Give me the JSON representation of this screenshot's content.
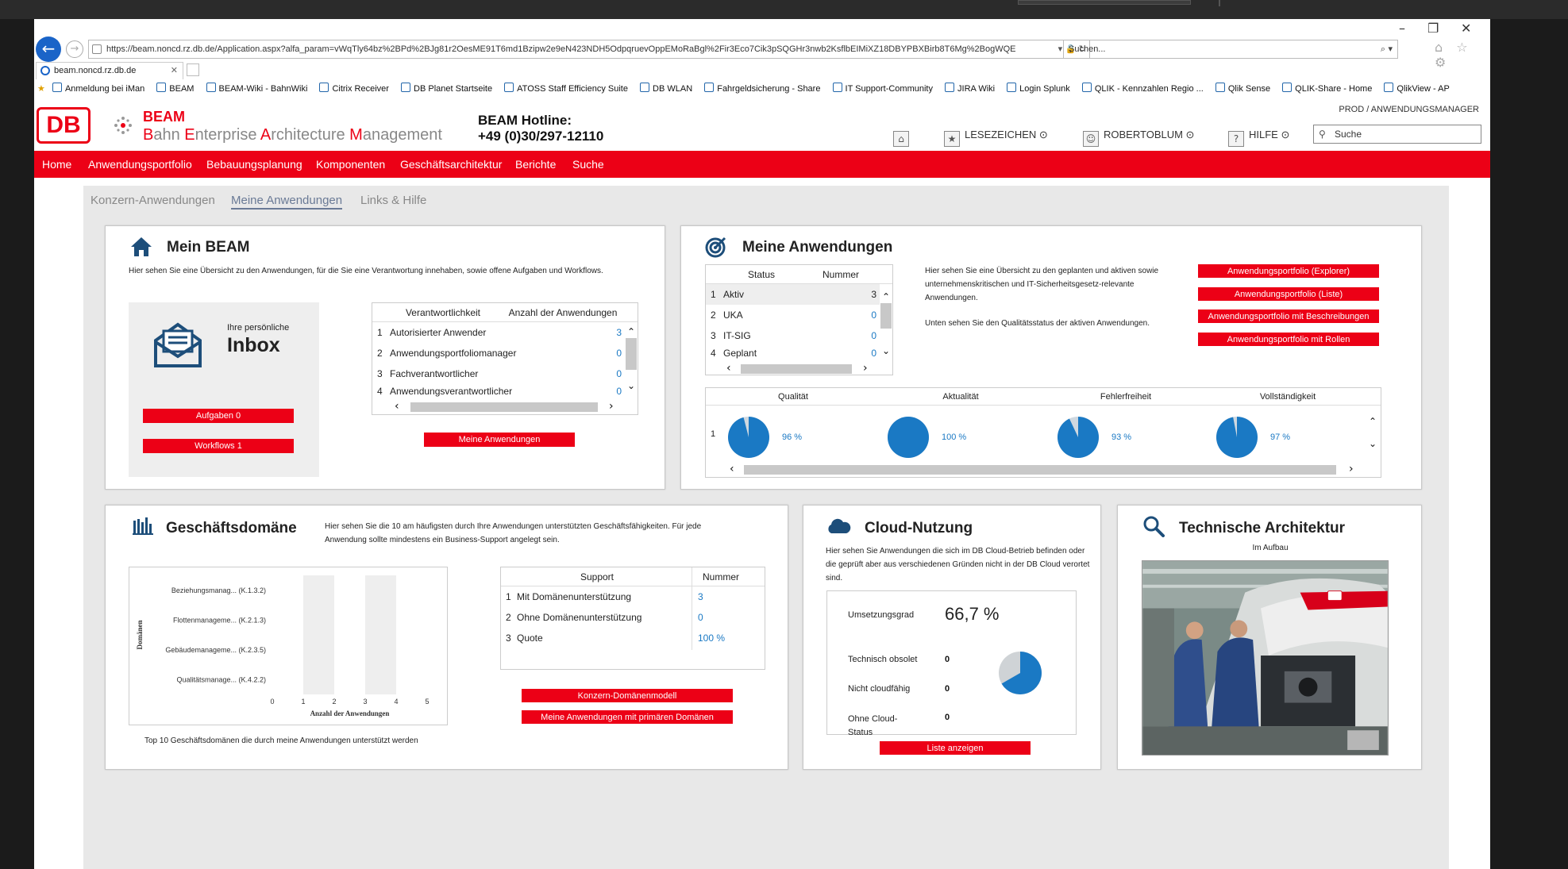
{
  "browser": {
    "url": "https://beam.noncd.rz.db.de/Application.aspx?alfa_param=vWqTly64bz%2BPd%2BJg81r2OesME91T6md1Bzipw2e9eN423NDH5OdpqruevOppEMoRaBgl%2Fir3Eco7Cik3pSQGHr3nwb2KsflbEIMiXZ18DBYPBXBirb8T6Mg%2BogWQE",
    "url_icons": "▾ 🔒 ↻",
    "search_placeholder": "Suchen...",
    "search_icon": "⌕ ▾",
    "tab_title": "beam.noncd.rz.db.de",
    "window_controls": {
      "minimize": "–",
      "restore": "❐",
      "close": "✕"
    },
    "chrome_icons": "⌂ ☆ ⚙",
    "favorites": [
      "Anmeldung bei iMan",
      "BEAM",
      "BEAM-Wiki - BahnWiki",
      "Citrix Receiver",
      "DB Planet Startseite",
      "ATOSS Staff Efficiency Suite",
      "DB WLAN",
      "Fahrgeldsicherung - Share",
      "IT Support-Community",
      "JIRA Wiki",
      "Login Splunk",
      "QLIK - Kennzahlen Regio ...",
      "Qlik Sense",
      "QLIK-Share - Home",
      "QlikView - AP"
    ]
  },
  "header": {
    "logo": "DB",
    "app_name": "BEAM",
    "app_subtitle_parts": [
      "B",
      "ahn ",
      "E",
      "nterprise ",
      "A",
      "rchitecture ",
      "M",
      "anagement"
    ],
    "hotline_label": "BEAM Hotline:",
    "hotline_number": "+49 (0)30/297-12110",
    "env_label": "PROD / ANWENDUNGSMANAGER",
    "home_icon": "home-icon",
    "bookmarks_label": "LESEZEICHEN ⊙",
    "user_label": "ROBERTOBLUM ⊙",
    "help_label": "HILFE ⊙",
    "search_placeholder": "Suche"
  },
  "nav": [
    "Home",
    "Anwendungsportfolio",
    "Bebauungsplanung",
    "Komponenten",
    "Geschäftsarchitektur",
    "Berichte",
    "Suche"
  ],
  "subtabs": [
    "Konzern-Anwendungen",
    "Meine Anwendungen",
    "Links & Hilfe"
  ],
  "mein_beam": {
    "title": "Mein BEAM",
    "desc": "Hier sehen Sie eine Übersicht zu den Anwendungen, für die Sie eine Verantwortung innehaben, sowie offene Aufgaben und Workflows.",
    "inbox_small": "Ihre persönliche",
    "inbox_big": "Inbox",
    "btn_tasks": "Aufgaben 0",
    "btn_workflows": "Workflows 1",
    "table_headers": [
      "Verantwortlichkeit",
      "Anzahl der Anwendungen"
    ],
    "rows": [
      {
        "n": "1",
        "label": "Autorisierter Anwender",
        "value": "3"
      },
      {
        "n": "2",
        "label": "Anwendungsportfoliomanager",
        "value": "0"
      },
      {
        "n": "3",
        "label": "Fachverantwortlicher",
        "value": "0"
      },
      {
        "n": "4",
        "label": "Anwendungsverantwortlicher",
        "value": "0"
      }
    ],
    "btn_apps": "Meine Anwendungen"
  },
  "meine_anwendungen": {
    "title": "Meine Anwendungen",
    "table_headers": [
      "Status",
      "Nummer"
    ],
    "rows": [
      {
        "n": "1",
        "label": "Aktiv",
        "value": "3"
      },
      {
        "n": "2",
        "label": "UKA",
        "value": "0"
      },
      {
        "n": "3",
        "label": "IT-SIG",
        "value": "0"
      },
      {
        "n": "4",
        "label": "Geplant",
        "value": "0"
      }
    ],
    "desc1": "Hier sehen Sie eine Übersicht zu den geplanten und aktiven sowie unternehmenskritischen und IT-Sicherheitsgesetz-relevante Anwendungen.",
    "desc2": "Unten sehen Sie den Qualitätsstatus der aktiven Anwendungen.",
    "buttons": [
      "Anwendungsportfolio (Explorer)",
      "Anwendungsportfolio (Liste)",
      "Anwendungsportfolio mit Beschreibungen",
      "Anwendungsportfolio mit Rollen"
    ],
    "quality_headers": [
      "Qualität",
      "Aktualität",
      "Fehlerfreiheit",
      "Vollständigkeit"
    ],
    "quality_row_n": "1",
    "quality_values": [
      {
        "label": "96 %",
        "fraction": 0.96
      },
      {
        "label": "100 %",
        "fraction": 1.0
      },
      {
        "label": "93 %",
        "fraction": 0.93
      },
      {
        "label": "97 %",
        "fraction": 0.97
      }
    ]
  },
  "geschaeftsdomaene": {
    "title": "Geschäftsdomäne",
    "desc": "Hier sehen Sie die 10 am häufigsten durch Ihre Anwendungen unterstützten Geschäftsfähigkeiten. Für jede Anwendung sollte mindestens ein Business-Support angelegt sein.",
    "caption": "Top 10 Geschäftsdomänen die durch meine Anwendungen unterstützt werden",
    "support_headers": [
      "Support",
      "Nummer"
    ],
    "support_rows": [
      {
        "n": "1",
        "label": "Mit Domänenunterstützung",
        "value": "3"
      },
      {
        "n": "2",
        "label": "Ohne Domänenunterstützung",
        "value": "0"
      },
      {
        "n": "3",
        "label": "Quote",
        "value": "100 %"
      }
    ],
    "buttons": [
      "Konzern-Domänenmodell",
      "Meine Anwendungen mit primären Domänen"
    ]
  },
  "chart_data": {
    "type": "bar",
    "orientation": "horizontal",
    "categories": [
      "Beziehungsmanag... (K.1.3.2)",
      "Flottenmanageme... (K.2.1.3)",
      "Gebäudemanageme... (K.2.3.5)",
      "Qualitätsmanage... (K.4.2.2)"
    ],
    "values": [
      0,
      0,
      0,
      0
    ],
    "xlabel": "Anzahl der Anwendungen",
    "ylabel": "Domänen",
    "xticks": [
      "0",
      "1",
      "2",
      "3",
      "4",
      "5"
    ],
    "xlim": [
      0,
      5
    ],
    "grid": "vertical alternating bands"
  },
  "cloud": {
    "title": "Cloud-Nutzung",
    "desc": "Hier sehen Sie Anwendungen die sich im DB Cloud-Betrieb befinden oder die geprüft aber aus verschiedenen Gründen nicht in der DB Cloud verortet sind.",
    "umsetzung_label": "Umsetzungsgrad",
    "umsetzung_value": "66,7 %",
    "umsetzung_fraction": 0.667,
    "items": [
      {
        "label": "Technisch obsolet",
        "value": "0"
      },
      {
        "label": "Nicht cloudfähig",
        "value": "0"
      },
      {
        "label": "Ohne Cloud-Status",
        "value": "0"
      }
    ],
    "btn": "Liste anzeigen"
  },
  "tech": {
    "title": "Technische Architektur",
    "subtitle": "Im Aufbau"
  },
  "colors": {
    "db_red": "#ec0016",
    "pie_blue": "#1a79c4",
    "link_blue": "#1a79c4"
  }
}
